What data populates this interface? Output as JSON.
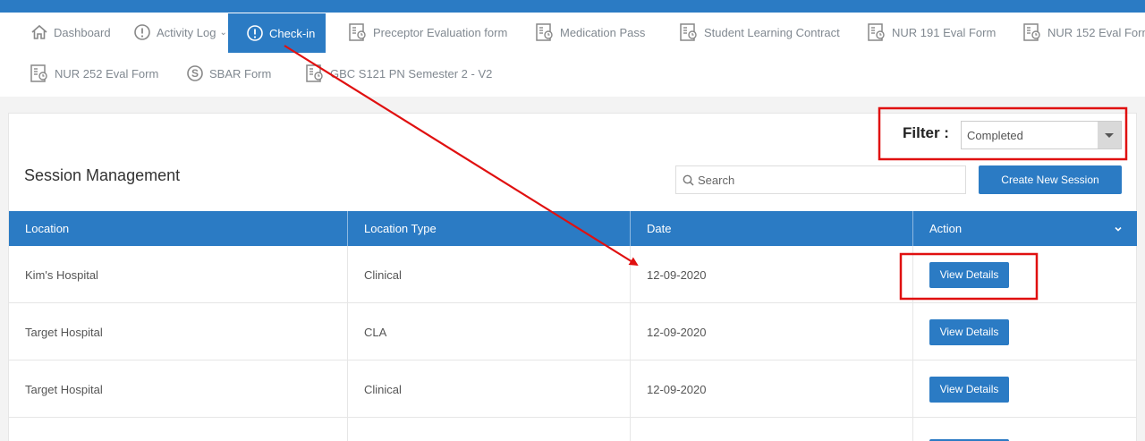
{
  "nav": {
    "items": [
      {
        "label": "Dashboard",
        "icon": "home-icon"
      },
      {
        "label": "Activity Log",
        "icon": "info-circle-icon",
        "has_dropdown": true
      },
      {
        "label": "Check-in",
        "icon": "info-circle-icon",
        "active": true
      },
      {
        "label": "Preceptor Evaluation form",
        "icon": "form-icon"
      },
      {
        "label": "Medication Pass",
        "icon": "form-icon"
      },
      {
        "label": "Student Learning Contract",
        "icon": "form-icon"
      },
      {
        "label": "NUR 191 Eval Form",
        "icon": "form-icon"
      },
      {
        "label": "NUR 152 Eval Form",
        "icon": "form-icon"
      },
      {
        "label": "NUR 252 Eval Form",
        "icon": "form-icon"
      },
      {
        "label": "SBAR Form",
        "icon": "s-circle-icon"
      },
      {
        "label": "GBC S121  PN Semester 2 - V2",
        "icon": "form-icon"
      }
    ]
  },
  "filter": {
    "label": "Filter :",
    "selected": "Completed"
  },
  "page": {
    "title": "Session Management"
  },
  "search": {
    "placeholder": "Search"
  },
  "actions": {
    "create_label": "Create New Session"
  },
  "table": {
    "headers": [
      "Location",
      "Location Type",
      "Date",
      "Action"
    ],
    "rows": [
      {
        "location": "Kim's Hospital",
        "type": "Clinical",
        "date": "12-09-2020",
        "action": "View Details"
      },
      {
        "location": "Target Hospital",
        "type": "CLA",
        "date": "12-09-2020",
        "action": "View Details"
      },
      {
        "location": "Target Hospital",
        "type": "Clinical",
        "date": "12-09-2020",
        "action": "View Details"
      }
    ]
  },
  "colors": {
    "primary": "#2b7bc4",
    "annotation": "#e01010"
  }
}
